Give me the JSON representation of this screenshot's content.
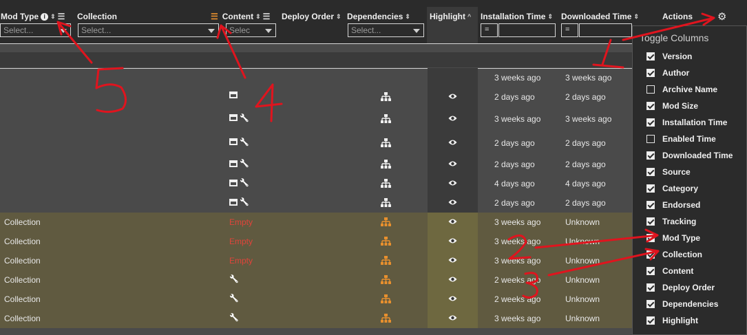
{
  "header": {
    "columns": [
      {
        "key": "mod_type",
        "label": "Mod Type"
      },
      {
        "key": "collection",
        "label": "Collection"
      },
      {
        "key": "content",
        "label": "Content"
      },
      {
        "key": "deploy_order",
        "label": "Deploy Order"
      },
      {
        "key": "dependencies",
        "label": "Dependencies"
      },
      {
        "key": "highlight",
        "label": "Highlight"
      },
      {
        "key": "installation_time",
        "label": "Installation Time"
      },
      {
        "key": "downloaded_time",
        "label": "Downloaded Time"
      },
      {
        "key": "actions",
        "label": "Actions"
      }
    ],
    "filters": {
      "mod_type_placeholder": "Select...",
      "collection_placeholder": "Select...",
      "content_placeholder": "Selec",
      "dependencies_placeholder": "Select...",
      "installation_op": "=",
      "downloaded_op": "="
    }
  },
  "rows": [
    {
      "mod_type": "",
      "content": [],
      "content_text": "",
      "dep": "",
      "eye": false,
      "install": "3 weeks ago",
      "download": "3 weeks ago",
      "style": "dark"
    },
    {
      "mod_type": "",
      "content": [
        "archive"
      ],
      "content_text": "",
      "dep": "normal",
      "eye": true,
      "install": "2 days ago",
      "download": "2 days ago",
      "style": "dark"
    },
    {
      "mod_type": "",
      "content": [
        "archive",
        "wrench"
      ],
      "content_text": "",
      "dep": "normal",
      "eye": true,
      "install": "3 weeks ago",
      "download": "3 weeks ago",
      "style": "dark"
    },
    {
      "mod_type": "",
      "content": [
        "archive",
        "wrench"
      ],
      "content_text": "",
      "dep": "normal",
      "eye": true,
      "install": "2 days ago",
      "download": "2 days ago",
      "style": "dark"
    },
    {
      "mod_type": "",
      "content": [
        "archive",
        "wrench"
      ],
      "content_text": "",
      "dep": "normal",
      "eye": true,
      "install": "2 days ago",
      "download": "2 days ago",
      "style": "dark"
    },
    {
      "mod_type": "",
      "content": [
        "archive",
        "wrench"
      ],
      "content_text": "",
      "dep": "normal",
      "eye": true,
      "install": "4 days ago",
      "download": "4 days ago",
      "style": "dark"
    },
    {
      "mod_type": "",
      "content": [
        "archive",
        "wrench"
      ],
      "content_text": "",
      "dep": "normal",
      "eye": true,
      "install": "2 days ago",
      "download": "2 days ago",
      "style": "dark"
    },
    {
      "mod_type": "Collection",
      "content": [],
      "content_text": "Empty",
      "dep": "orange",
      "eye": true,
      "install": "3 weeks ago",
      "download": "Unknown",
      "style": "olive"
    },
    {
      "mod_type": "Collection",
      "content": [],
      "content_text": "Empty",
      "dep": "orange",
      "eye": true,
      "install": "3 weeks ago",
      "download": "Unknown",
      "style": "olive"
    },
    {
      "mod_type": "Collection",
      "content": [],
      "content_text": "Empty",
      "dep": "orange",
      "eye": true,
      "install": "3 weeks ago",
      "download": "Unknown",
      "style": "olive"
    },
    {
      "mod_type": "Collection",
      "content": [
        "wrench"
      ],
      "content_text": "",
      "dep": "orange",
      "eye": true,
      "install": "2 weeks ago",
      "download": "Unknown",
      "style": "olive"
    },
    {
      "mod_type": "Collection",
      "content": [
        "wrench"
      ],
      "content_text": "",
      "dep": "orange",
      "eye": true,
      "install": "2 weeks ago",
      "download": "Unknown",
      "style": "olive"
    },
    {
      "mod_type": "Collection",
      "content": [
        "wrench"
      ],
      "content_text": "",
      "dep": "orange",
      "eye": true,
      "install": "3 weeks ago",
      "download": "Unknown",
      "style": "olive"
    }
  ],
  "toggle_panel": {
    "title": "Toggle Columns",
    "options": [
      {
        "label": "Version",
        "checked": true
      },
      {
        "label": "Author",
        "checked": true
      },
      {
        "label": "Archive Name",
        "checked": false
      },
      {
        "label": "Mod Size",
        "checked": true
      },
      {
        "label": "Installation Time",
        "checked": true
      },
      {
        "label": "Enabled Time",
        "checked": false
      },
      {
        "label": "Downloaded Time",
        "checked": true
      },
      {
        "label": "Source",
        "checked": true
      },
      {
        "label": "Category",
        "checked": true
      },
      {
        "label": "Endorsed",
        "checked": true
      },
      {
        "label": "Tracking",
        "checked": true
      },
      {
        "label": "Mod Type",
        "checked": true
      },
      {
        "label": "Collection",
        "checked": true
      },
      {
        "label": "Content",
        "checked": true
      },
      {
        "label": "Deploy Order",
        "checked": true
      },
      {
        "label": "Dependencies",
        "checked": true
      },
      {
        "label": "Highlight",
        "checked": true
      }
    ]
  },
  "annotations": [
    "1",
    "2",
    "3",
    "4",
    "5"
  ],
  "icons": {
    "info": "info-icon",
    "list": "list-icon",
    "sort": "sort-icon",
    "gear": "gear-icon",
    "archive": "archive-icon",
    "wrench": "wrench-icon",
    "dependency": "dependency-icon",
    "eye": "eye-icon"
  },
  "colors": {
    "empty_text": "#e0443a",
    "dependency_orange": "#e8902e",
    "annotation_red": "#e0141e",
    "collection_row": "#605a40"
  }
}
